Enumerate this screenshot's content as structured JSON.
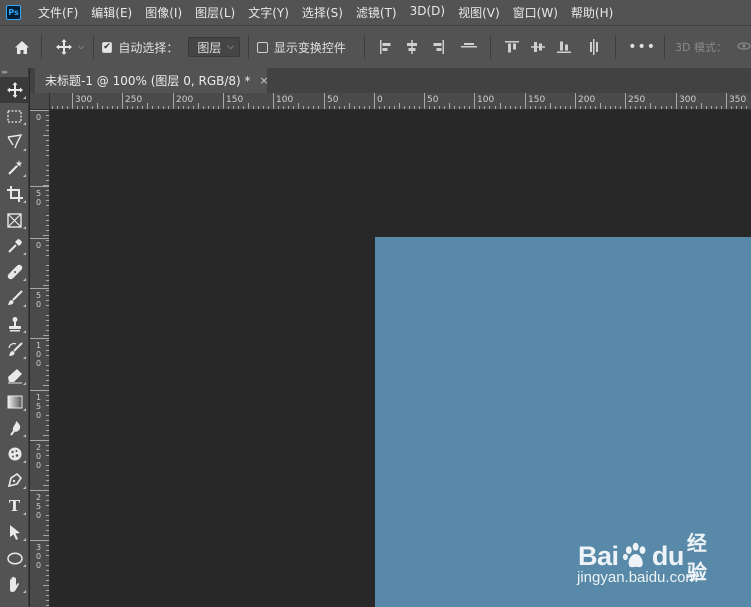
{
  "app": {
    "logo_text": "Ps"
  },
  "menu": {
    "items": [
      "文件(F)",
      "编辑(E)",
      "图像(I)",
      "图层(L)",
      "文字(Y)",
      "选择(S)",
      "滤镜(T)",
      "3D(D)",
      "视图(V)",
      "窗口(W)",
      "帮助(H)"
    ]
  },
  "options_bar": {
    "auto_select_label": "自动选择：",
    "auto_select_checked": true,
    "auto_select_target": "图层",
    "show_transform_label": "显示变换控件",
    "show_transform_checked": false,
    "more_label": "•••",
    "mode_3d_label": "3D 模式："
  },
  "document_tab": {
    "title": "未标题-1 @ 100% (图层 0, RGB/8) *",
    "close_glyph": "×"
  },
  "rulers": {
    "horizontal_labels": [
      "300",
      "250",
      "200",
      "150",
      "100",
      "50",
      "0",
      "50",
      "100",
      "150",
      "200",
      "250",
      "300",
      "350"
    ],
    "vertical_labels": [
      "0",
      "50",
      "0",
      "50",
      "100",
      "150",
      "200",
      "250",
      "300"
    ]
  },
  "toolbar": {
    "tools": [
      "move",
      "marquee",
      "lasso",
      "magic-wand",
      "crop",
      "frame",
      "eyedropper",
      "healing-brush",
      "brush",
      "clone-stamp",
      "history-brush",
      "eraser",
      "gradient",
      "blur",
      "dodge",
      "pen",
      "type",
      "path-selection",
      "ellipse",
      "hand"
    ],
    "type_glyph": "T"
  },
  "canvas": {
    "workspace_color": "#282828",
    "artboard_color": "#5889a8"
  },
  "watermark": {
    "brand_left": "Bai",
    "brand_right": "du",
    "product": "经验",
    "url": "jingyan.baidu.com"
  }
}
